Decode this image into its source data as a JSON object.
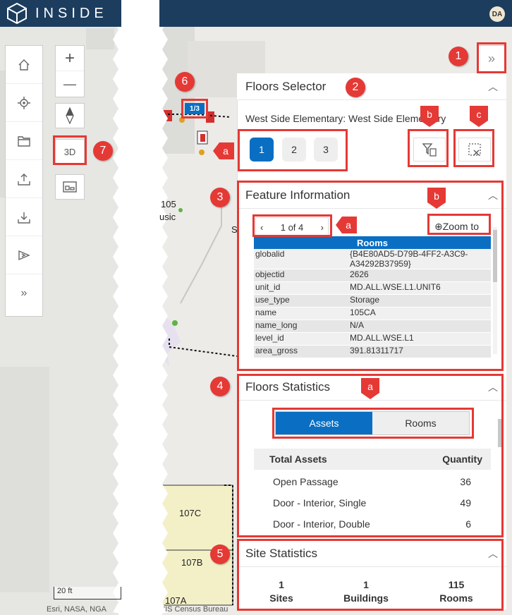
{
  "app": {
    "title": "INSIDE",
    "user_initials": "DA"
  },
  "toolbar": {
    "items": [
      {
        "icon": "home-icon"
      },
      {
        "icon": "locate-icon"
      },
      {
        "icon": "folder-icon"
      },
      {
        "icon": "upload-icon"
      },
      {
        "icon": "download-icon"
      },
      {
        "icon": "sketch-icon"
      },
      {
        "icon": "expand-icon"
      }
    ]
  },
  "map_controls": {
    "zoom_in": "+",
    "zoom_out": "—",
    "view_3d": "3D"
  },
  "map": {
    "floor_badge": "1/3",
    "labels": [
      "105",
      "usic",
      "S",
      "107C",
      "107B",
      "107A"
    ],
    "scale": "20 ft",
    "attribution_left": "Esri, NASA, NGA",
    "attribution_right": "'IS Census Bureau"
  },
  "floors_selector": {
    "title": "Floors Selector",
    "building": "West Side Elementary: West Side Elementary",
    "floors": [
      "1",
      "2",
      "3"
    ],
    "active_floor": "1"
  },
  "feature_info": {
    "title": "Feature Information",
    "pager": "1 of 4",
    "zoom_to": "Zoom to",
    "layer": "Rooms",
    "rows": [
      {
        "field": "globalid",
        "value": "{B4E80AD5-D79B-4FF2-A3C9-A34292B37959}"
      },
      {
        "field": "objectid",
        "value": "2626"
      },
      {
        "field": "unit_id",
        "value": "MD.ALL.WSE.L1.UNIT6"
      },
      {
        "field": "use_type",
        "value": "Storage"
      },
      {
        "field": "name",
        "value": "105CA"
      },
      {
        "field": "name_long",
        "value": "N/A"
      },
      {
        "field": "level_id",
        "value": "MD.ALL.WSE.L1"
      },
      {
        "field": "area_gross",
        "value": "391.81311717"
      }
    ]
  },
  "floors_stats": {
    "title": "Floors Statistics",
    "tabs": [
      "Assets",
      "Rooms"
    ],
    "active_tab": "Assets",
    "header": [
      "Total Assets",
      "Quantity"
    ],
    "rows": [
      {
        "name": "Open Passage",
        "qty": "36"
      },
      {
        "name": "Door - Interior, Single",
        "qty": "49"
      },
      {
        "name": "Door - Interior, Double",
        "qty": "6"
      }
    ]
  },
  "site_stats": {
    "title": "Site Statistics",
    "items": [
      {
        "value": "1",
        "label": "Sites"
      },
      {
        "value": "1",
        "label": "Buildings"
      },
      {
        "value": "115",
        "label": "Rooms"
      }
    ]
  },
  "annotations": {
    "numbers": [
      "1",
      "2",
      "3",
      "4",
      "5",
      "6",
      "7"
    ],
    "letters": [
      "a",
      "b",
      "c"
    ]
  },
  "colors": {
    "header": "#1c3d5e",
    "accent": "#0a6fc2",
    "callout": "#e53935"
  }
}
